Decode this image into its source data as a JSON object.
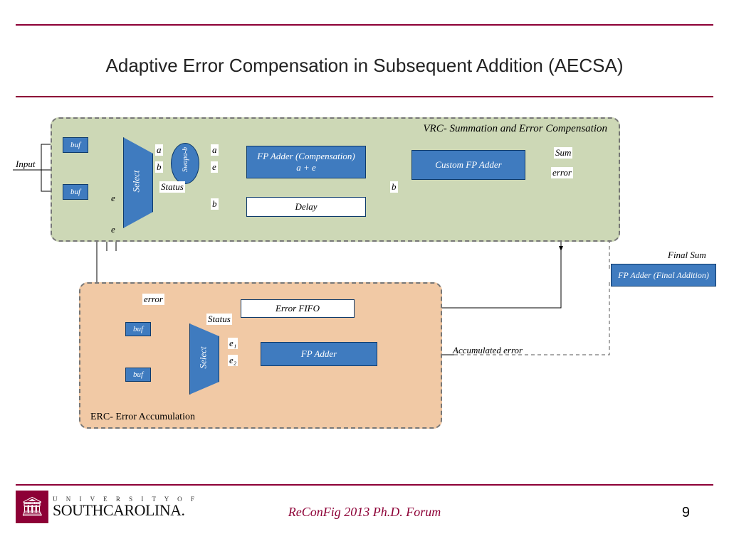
{
  "title": "Adaptive Error Compensation in Subsequent Addition (AECSA)",
  "footer": {
    "center": "ReConFig 2013 Ph.D. Forum",
    "page": "9"
  },
  "logo": {
    "line1": "U N I V E R S I T Y   O F",
    "line2": "SOUTHCAROLINA."
  },
  "zones": {
    "vrc": "VRC- Summation and Error Compensation",
    "erc": "ERC- Error Accumulation"
  },
  "labels": {
    "input": "Input",
    "buf": "buf",
    "a": "a",
    "b": "b",
    "e": "e",
    "status": "Status",
    "sum": "Sum",
    "error": "error",
    "e1": "e₁",
    "e2": "e₂",
    "accum": "Accumulated error",
    "finalsum": "Final Sum"
  },
  "blocks": {
    "select": "Select",
    "swap": "Swapa-b",
    "fpcomp": "FP Adder (Compensation)\na + e",
    "delay": "Delay",
    "custom": "Custom FP Adder",
    "final": "FP Adder (Final Addition)",
    "fifo": "Error FIFO",
    "fpadder": "FP Adder"
  }
}
